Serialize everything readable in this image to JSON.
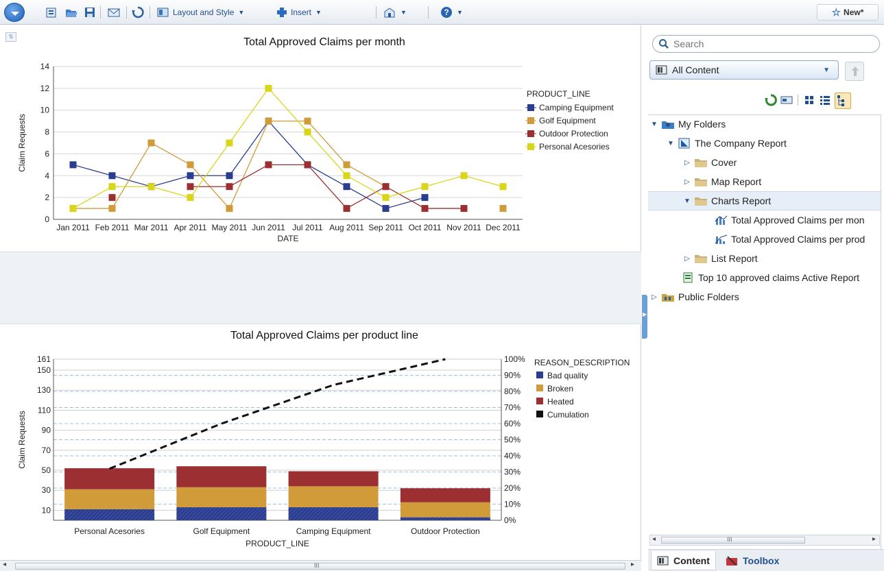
{
  "toolbar": {
    "layout_label": "Layout and Style",
    "insert_label": "Insert",
    "new_label": "New*"
  },
  "chart1": {
    "title": "Total Approved Claims per month",
    "legend_title": "PRODUCT_LINE",
    "xlabel": "DATE",
    "ylabel": "Claim Requests"
  },
  "chart2": {
    "title": "Total Approved Claims per product line",
    "legend_title": "REASON_DESCRIPTION",
    "xlabel": "PRODUCT_LINE",
    "ylabel": "Claim Requests"
  },
  "chart_data": [
    {
      "type": "line",
      "title": "Total Approved Claims per month",
      "xlabel": "DATE",
      "ylabel": "Claim Requests",
      "ylim": [
        0,
        14
      ],
      "yticks": [
        0,
        2,
        4,
        6,
        8,
        10,
        12,
        14
      ],
      "grid": true,
      "legend": "right",
      "categories": [
        "Jan 2011",
        "Feb 2011",
        "Mar 2011",
        "Apr 2011",
        "May 2011",
        "Jun 2011",
        "Jul 2011",
        "Aug 2011",
        "Sep 2011",
        "Oct 2011",
        "Nov 2011",
        "Dec 2011"
      ],
      "series": [
        {
          "name": "Camping Equipment",
          "color": "#2b3d8f",
          "values": [
            5,
            4,
            3,
            4,
            4,
            9,
            5,
            3,
            1,
            2,
            null,
            null
          ]
        },
        {
          "name": "Golf Equipment",
          "color": "#d19b3a",
          "values": [
            1,
            1,
            7,
            5,
            1,
            9,
            9,
            5,
            3,
            null,
            null,
            1
          ]
        },
        {
          "name": "Outdoor Protection",
          "color": "#9b2f32",
          "values": [
            null,
            2,
            null,
            3,
            3,
            5,
            5,
            1,
            3,
            1,
            1,
            null
          ]
        },
        {
          "name": "Personal Acesories",
          "color": "#d9d619",
          "values": [
            1,
            3,
            3,
            2,
            7,
            12,
            8,
            4,
            2,
            3,
            4,
            3
          ]
        }
      ]
    },
    {
      "type": "bar",
      "stacked": true,
      "title": "Total Approved Claims per product line",
      "xlabel": "PRODUCT_LINE",
      "ylabel": "Claim Requests",
      "ylim": [
        0,
        161
      ],
      "yticks": [
        10,
        30,
        50,
        70,
        90,
        110,
        130,
        150,
        161
      ],
      "y2ticks": [
        "0%",
        "10%",
        "20%",
        "30%",
        "40%",
        "50%",
        "60%",
        "70%",
        "80%",
        "90%",
        "100%"
      ],
      "legend": "right",
      "categories": [
        "Personal Acesories",
        "Golf Equipment",
        "Camping Equipment",
        "Outdoor Protection"
      ],
      "series": [
        {
          "name": "Bad quality",
          "color": "#2b3d8f",
          "values": [
            11,
            13,
            13,
            3
          ]
        },
        {
          "name": "Broken",
          "color": "#d19b3a",
          "values": [
            20,
            20,
            21,
            15
          ]
        },
        {
          "name": "Heated",
          "color": "#9b2f32",
          "values": [
            21,
            21,
            15,
            14
          ]
        },
        {
          "name": "Cumulation",
          "color": "#111111",
          "values": [
            32,
            60,
            84,
            100
          ]
        }
      ]
    }
  ],
  "panel": {
    "search_placeholder": "Search",
    "content_select": "All Content",
    "tree": [
      {
        "label": "My Folders",
        "icon": "my-folders-icon"
      },
      {
        "label": "The Company Report",
        "icon": "report-icon"
      },
      {
        "label": "Cover",
        "icon": "folder-icon"
      },
      {
        "label": "Map Report",
        "icon": "folder-icon"
      },
      {
        "label": "Charts Report",
        "icon": "folder-icon"
      },
      {
        "label": "Total Approved Claims per mon",
        "icon": "line-chart-icon"
      },
      {
        "label": "Total Approved Claims per prod",
        "icon": "pareto-chart-icon"
      },
      {
        "label": "List Report",
        "icon": "folder-icon"
      },
      {
        "label": "Top 10 approved claims Active Report",
        "icon": "active-report-icon"
      },
      {
        "label": "Public Folders",
        "icon": "public-folders-icon"
      }
    ],
    "tabs": [
      {
        "label": "Content"
      },
      {
        "label": "Toolbox"
      }
    ],
    "scroll_mark": "III"
  },
  "canvas_scroll_mark": "III"
}
